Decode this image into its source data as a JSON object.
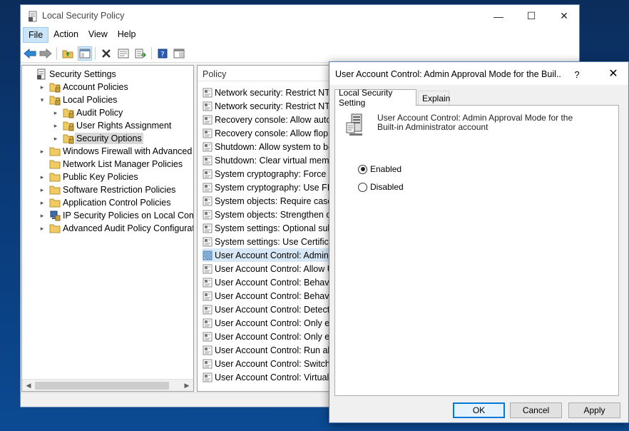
{
  "window": {
    "title": "Local Security Policy",
    "controls": {
      "minimize": "—",
      "maximize": "☐",
      "close": "✕"
    }
  },
  "menu": [
    "File",
    "Action",
    "View",
    "Help"
  ],
  "toolbar": [
    "back-arrow-icon",
    "forward-arrow-icon",
    "up-folder-icon",
    "show-hide-tree-icon",
    "delete-icon",
    "properties-icon",
    "export-list-icon",
    "help-icon",
    "console-view-icon"
  ],
  "tree": [
    {
      "label": "Security Settings",
      "level": 0,
      "expander": "",
      "icon": "security-settings-icon"
    },
    {
      "label": "Account Policies",
      "level": 1,
      "expander": "▸",
      "icon": "policy-folder-icon"
    },
    {
      "label": "Local Policies",
      "level": 1,
      "expander": "▾",
      "icon": "policy-folder-icon"
    },
    {
      "label": "Audit Policy",
      "level": 2,
      "expander": "▸",
      "icon": "policy-folder-icon"
    },
    {
      "label": "User Rights Assignment",
      "level": 2,
      "expander": "▸",
      "icon": "policy-folder-icon"
    },
    {
      "label": "Security Options",
      "level": 2,
      "expander": "▸",
      "icon": "policy-folder-icon",
      "selected": true
    },
    {
      "label": "Windows Firewall with Advanced Secu",
      "level": 1,
      "expander": "▸",
      "icon": "folder-icon"
    },
    {
      "label": "Network List Manager Policies",
      "level": 1,
      "expander": "",
      "icon": "folder-icon"
    },
    {
      "label": "Public Key Policies",
      "level": 1,
      "expander": "▸",
      "icon": "folder-icon"
    },
    {
      "label": "Software Restriction Policies",
      "level": 1,
      "expander": "▸",
      "icon": "folder-icon"
    },
    {
      "label": "Application Control Policies",
      "level": 1,
      "expander": "▸",
      "icon": "folder-icon"
    },
    {
      "label": "IP Security Policies on Local Compute",
      "level": 1,
      "expander": "▸",
      "icon": "ip-security-icon"
    },
    {
      "label": "Advanced Audit Policy Configuration",
      "level": 1,
      "expander": "▸",
      "icon": "folder-icon"
    }
  ],
  "list": {
    "header": "Policy",
    "items": [
      "Network security: Restrict NTLM",
      "Network security: Restrict NTLM",
      "Recovery console: Allow autom",
      "Recovery console: Allow floppy",
      "Shutdown: Allow system to be",
      "Shutdown: Clear virtual memo",
      "System cryptography: Force str",
      "System cryptography: Use FIPS",
      "System objects: Require case in",
      "System objects: Strengthen def",
      "System settings: Optional subs",
      "System settings: Use Certificate",
      "User Account Control: Admin A",
      "User Account Control: Allow U",
      "User Account Control: Behavio",
      "User Account Control: Behavio",
      "User Account Control: Detect a",
      "User Account Control: Only ele",
      "User Account Control: Only ele",
      "User Account Control: Run all a",
      "User Account Control: Switch t",
      "User Account Control: Virtualiz"
    ],
    "selected_index": 12
  },
  "dialog": {
    "title": "User Account Control: Admin Approval Mode for the Buil...",
    "help": "?",
    "close": "✕",
    "tabs": [
      "Local Security Setting",
      "Explain"
    ],
    "description": "User Account Control: Admin Approval Mode for the Built-in Administrator account",
    "options": [
      {
        "label": "Enabled",
        "checked": true
      },
      {
        "label": "Disabled",
        "checked": false
      }
    ],
    "buttons": {
      "ok": "OK",
      "cancel": "Cancel",
      "apply": "Apply"
    }
  }
}
